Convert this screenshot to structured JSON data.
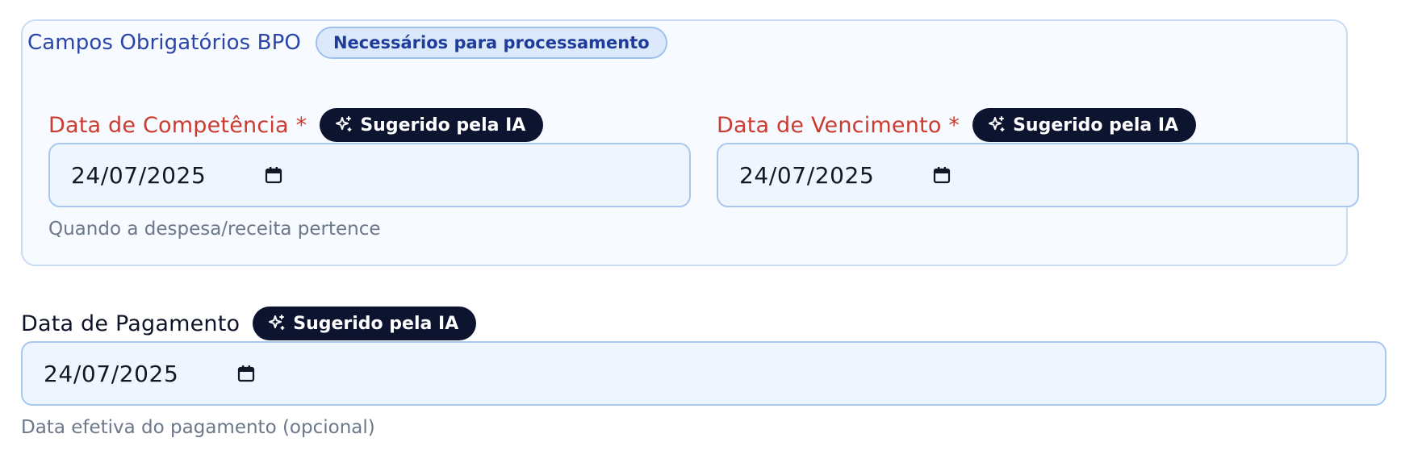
{
  "bpo_section": {
    "title": "Campos Obrigatórios BPO",
    "badge": "Necessários para processamento"
  },
  "fields": {
    "competencia": {
      "label": "Data de Competência",
      "required_marker": "*",
      "ai_badge": "Sugerido pela IA",
      "value": "24/07/2025",
      "helper": "Quando a despesa/receita pertence"
    },
    "vencimento": {
      "label": "Data de Vencimento",
      "required_marker": "*",
      "ai_badge": "Sugerido pela IA",
      "value": "24/07/2025"
    },
    "pagamento": {
      "label": "Data de Pagamento",
      "ai_badge": "Sugerido pela IA",
      "value": "24/07/2025",
      "helper": "Data efetiva do pagamento (opcional)"
    }
  },
  "icons": {
    "ai_badge_icon": "sparkles-icon",
    "date_picker_icon": "calendar-icon"
  },
  "colors": {
    "section_title": "#2a45a8",
    "required_label": "#cc3b2f",
    "ai_badge_bg": "#0c1430",
    "input_bg": "#eff5fe",
    "input_border": "#a8c8ef"
  }
}
